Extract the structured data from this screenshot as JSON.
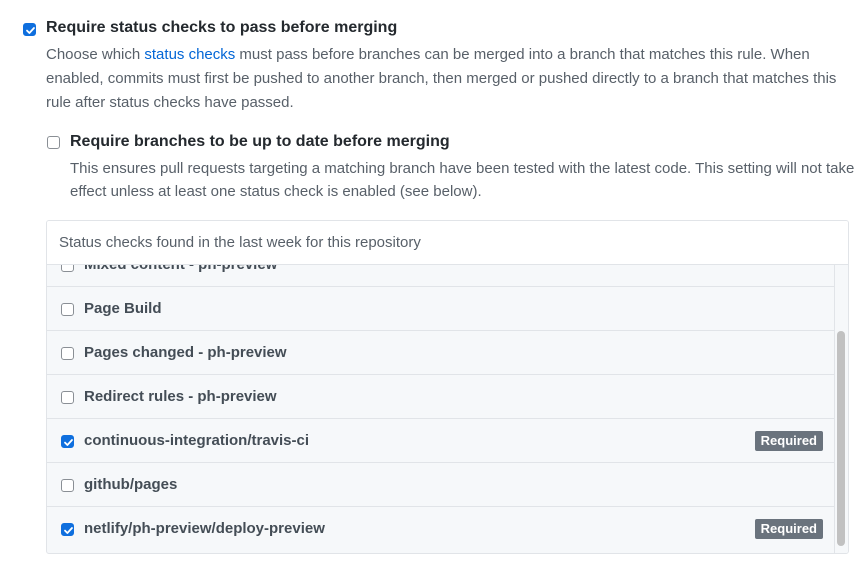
{
  "main_rule": {
    "checked": true,
    "title": "Require status checks to pass before merging",
    "desc_part1": "Choose which ",
    "desc_link": "status checks",
    "desc_part2": " must pass before branches can be merged into a branch that matches this rule. When enabled, commits must first be pushed to another branch, then merged or pushed directly to a branch that matches this rule after status checks have passed."
  },
  "sub_rule": {
    "checked": false,
    "title": "Require branches to be up to date before merging",
    "desc": "This ensures pull requests targeting a matching branch have been tested with the latest code. This setting will not take effect unless at least one status check is enabled (see below)."
  },
  "status_panel": {
    "header": "Status checks found in the last week for this repository",
    "checks": [
      {
        "label": "Mixed content - ph-preview",
        "checked": false,
        "required": false
      },
      {
        "label": "Page Build",
        "checked": false,
        "required": false
      },
      {
        "label": "Pages changed - ph-preview",
        "checked": false,
        "required": false
      },
      {
        "label": "Redirect rules - ph-preview",
        "checked": false,
        "required": false
      },
      {
        "label": "continuous-integration/travis-ci",
        "checked": true,
        "required": true,
        "badge": "Required"
      },
      {
        "label": "github/pages",
        "checked": false,
        "required": false
      },
      {
        "label": "netlify/ph-preview/deploy-preview",
        "checked": true,
        "required": true,
        "badge": "Required"
      }
    ]
  },
  "colors": {
    "checkbox_checked": "#0f6fde",
    "link": "#0366d6",
    "badge_bg": "#6a737d"
  }
}
